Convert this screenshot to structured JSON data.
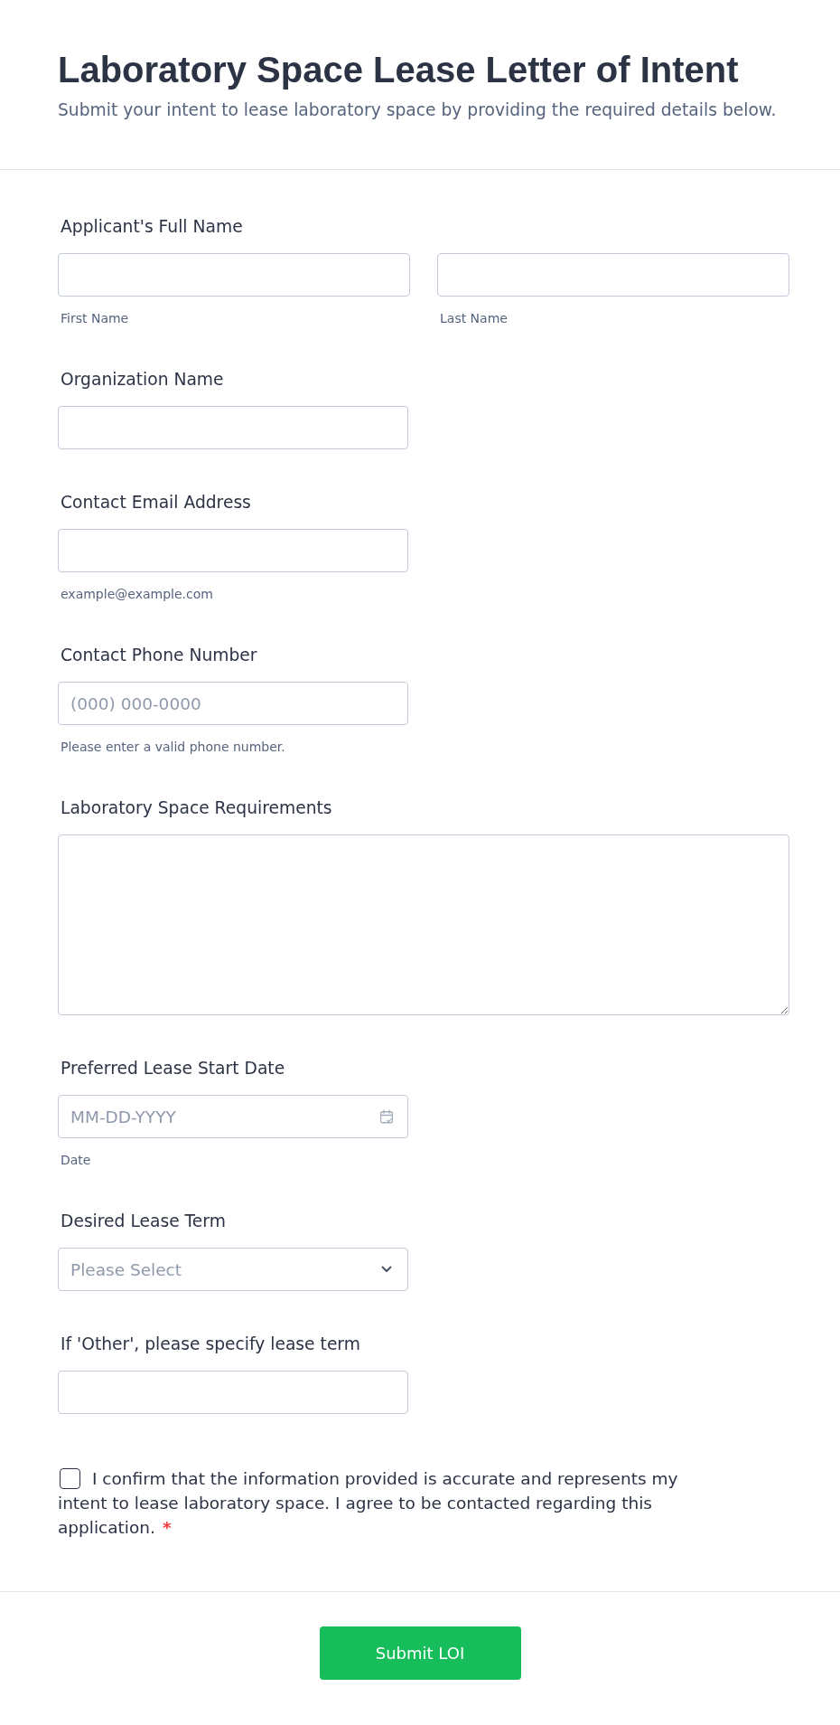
{
  "header": {
    "title": "Laboratory Space Lease Letter of Intent",
    "subtitle": "Submit your intent to lease laboratory space by providing the required details below."
  },
  "fields": [
    {
      "kind": "name",
      "label": "Applicant's Full Name",
      "parts": [
        {
          "sublabel": "First Name"
        },
        {
          "sublabel": "Last Name"
        }
      ]
    },
    {
      "kind": "text",
      "label": "Organization Name"
    },
    {
      "kind": "email",
      "label": "Contact Email Address",
      "sublabel": "example@example.com"
    },
    {
      "kind": "phone",
      "label": "Contact Phone Number",
      "placeholder": "(000) 000-0000",
      "sublabel": "Please enter a valid phone number."
    },
    {
      "kind": "textarea",
      "label": "Laboratory Space Requirements"
    },
    {
      "kind": "date",
      "label": "Preferred Lease Start Date",
      "placeholder": "MM-DD-YYYY",
      "sublabel": "Date"
    },
    {
      "kind": "select",
      "label": "Desired Lease Term",
      "placeholder": "Please Select"
    },
    {
      "kind": "text",
      "label": "If 'Other', please specify lease term"
    },
    {
      "kind": "checkbox",
      "label": "I confirm that the information provided is accurate and represents my intent to lease laboratory space. I agree to be contacted regarding this application.",
      "checked": false,
      "required_mark": "*"
    }
  ],
  "submit": {
    "label": "Submit LOI"
  }
}
